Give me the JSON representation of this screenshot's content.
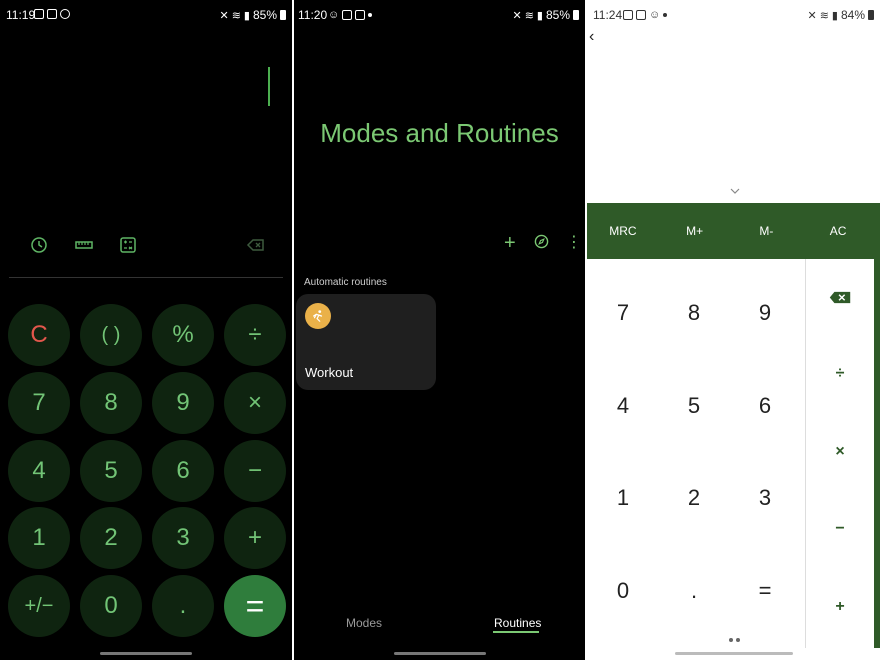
{
  "screen1": {
    "status": {
      "time": "11:19",
      "battery": "85%"
    },
    "tools": [
      "history-icon",
      "ruler-icon",
      "scientific-icon",
      "backspace-icon"
    ],
    "keys": [
      [
        "C",
        "( )",
        "%",
        "÷"
      ],
      [
        "7",
        "8",
        "9",
        "×"
      ],
      [
        "4",
        "5",
        "6",
        "−"
      ],
      [
        "1",
        "2",
        "3",
        "+"
      ],
      [
        "+/−",
        "0",
        ".",
        "="
      ]
    ],
    "colors": {
      "accent": "#72c476",
      "clear": "#e2574c",
      "equals_bg": "#2f7d3c",
      "key_bg": "#0f2410"
    }
  },
  "screen2": {
    "status": {
      "time": "11:20",
      "battery": "85%"
    },
    "title": "Modes and Routines",
    "actions": [
      "add-icon",
      "discover-icon",
      "more-icon"
    ],
    "section_label": "Automatic routines",
    "routine": {
      "label": "Workout",
      "icon": "running-icon",
      "icon_color": "#eab149"
    },
    "tabs": {
      "modes": "Modes",
      "routines": "Routines",
      "active": "Routines"
    }
  },
  "screen3": {
    "status": {
      "time": "11:24",
      "battery": "84%"
    },
    "memory": [
      "MRC",
      "M+",
      "M-",
      "AC"
    ],
    "numpad": [
      [
        "7",
        "8",
        "9"
      ],
      [
        "4",
        "5",
        "6"
      ],
      [
        "1",
        "2",
        "3"
      ],
      [
        "0",
        ".",
        "="
      ]
    ],
    "operators": [
      "÷",
      "×",
      "−",
      "+"
    ],
    "colors": {
      "brand": "#2f5a28"
    }
  }
}
